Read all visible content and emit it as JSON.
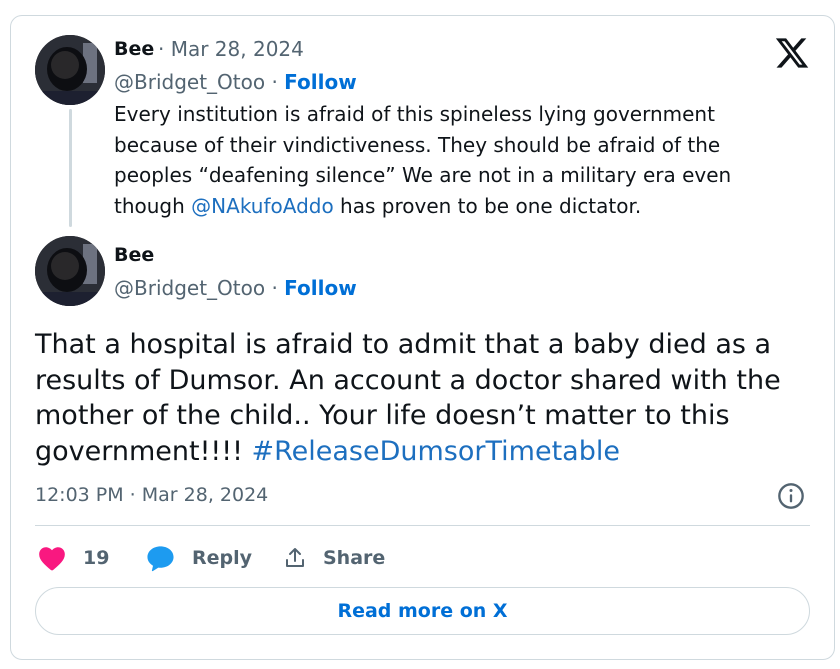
{
  "brand": {
    "logo_icon": "x-logo-icon"
  },
  "quoted_tweet": {
    "author_name": "Bee",
    "date": "· Mar 28, 2024",
    "handle": "@Bridget_Otoo",
    "separator": " · ",
    "follow_label": "Follow",
    "text_part1": "Every institution is afraid of this spineless lying government because of their vindictiveness. They should be afraid of the peoples “deafening silence” We are not in a military era even though ",
    "mention": "@NAkufoAddo",
    "text_part2": " has proven to be one dictator."
  },
  "main_tweet": {
    "author_name": "Bee",
    "handle": "@Bridget_Otoo",
    "separator": " · ",
    "follow_label": "Follow",
    "text": "That a hospital is afraid to admit that a baby died as a results of Dumsor. An account a doctor shared with the mother of the child.. Your life doesn’t matter to this government!!!! ",
    "hashtag": "#ReleaseDumsorTimetable",
    "timestamp": "12:03 PM · Mar 28, 2024"
  },
  "actions": {
    "like_count": "19",
    "reply_label": "Reply",
    "share_label": "Share"
  },
  "read_more_label": "Read more on X",
  "colors": {
    "text": "#0f1419",
    "muted": "#536471",
    "link": "#006fd6",
    "like_heart": "#f91880",
    "reply_bubble": "#1d9bf0",
    "border": "#cfd9de"
  }
}
